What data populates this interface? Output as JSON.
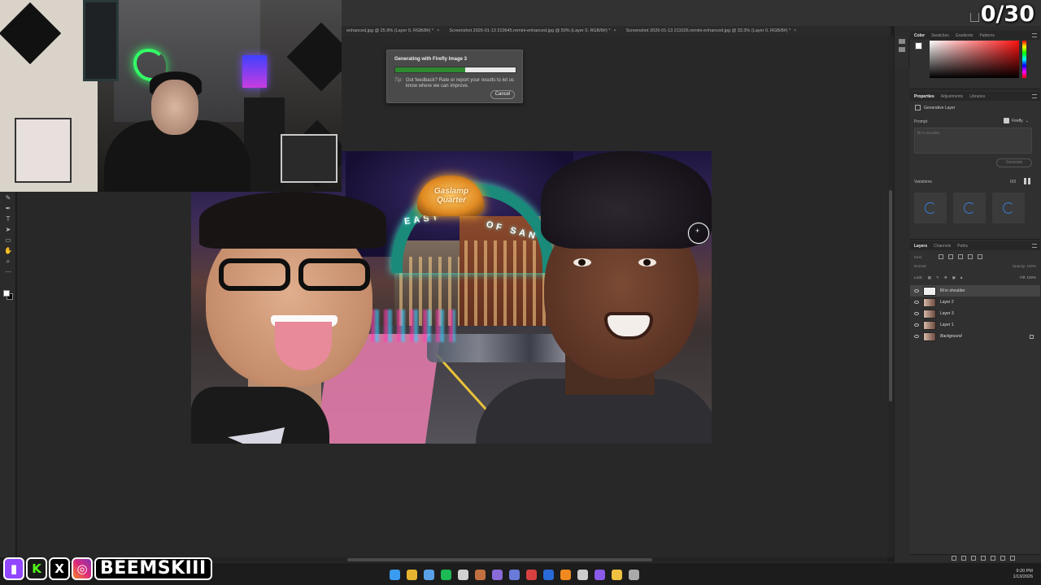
{
  "overlay": {
    "counter": "0/30",
    "handle": "BEEMSKIII",
    "social_icons": [
      "twitch-icon",
      "kick-icon",
      "x-icon",
      "instagram-icon"
    ]
  },
  "tabs": [
    {
      "label": "enhanced.jpg @ 25.9% (Layer 0, RGB/8#) *"
    },
    {
      "label": "Screenshot 2026-01-13 210645.remini-enhanced.jpg @ 50% (Layer 0, RGB/8#) *"
    },
    {
      "label": "Screenshot 2026-01-13 211026.remini-enhanced.jpg @ 33.3% (Layer 0, RGB/8#) *"
    }
  ],
  "dialog": {
    "title": "Generating with Firefly Image 3",
    "progress": 0.58,
    "tip_label": "Tip:",
    "tip_text": "Got feedback? Rate or report your results to let us know where we can improve.",
    "cancel_label": "Cancel"
  },
  "photo": {
    "sign_text": "Gaslamp Quarter",
    "arch_left": "EAST",
    "arch_right": "OF SAN"
  },
  "color_panel": {
    "tabs": [
      "Color",
      "Swatches",
      "Gradients",
      "Patterns"
    ],
    "active_tab": "Color"
  },
  "properties_panel": {
    "tabs": [
      "Properties",
      "Adjustments",
      "Libraries"
    ],
    "layer_type": "Generative Layer",
    "prompt_label": "Prompt",
    "model": "Firefly",
    "prompt_value": "fill in shoulder",
    "generate_label": "Generate",
    "variations_label": "Variations",
    "variations_count": "0/3"
  },
  "layers_panel": {
    "tabs": [
      "Layers",
      "Channels",
      "Paths"
    ],
    "filter_label": "Kind",
    "blend_mode": "Normal",
    "opacity_label": "Opacity:",
    "opacity_value": "100%",
    "lock_label": "Lock:",
    "fill_label": "Fill:",
    "fill_value": "100%",
    "layers": [
      {
        "name": "fill in shoulder",
        "active": true
      },
      {
        "name": "Layer 2",
        "active": false
      },
      {
        "name": "Layer 3",
        "active": false
      },
      {
        "name": "Layer 1",
        "active": false
      },
      {
        "name": "Background",
        "active": false
      }
    ]
  },
  "taskbar": {
    "apps": [
      {
        "name": "windows-start-icon",
        "color": "#3a9bf0"
      },
      {
        "name": "chrome-icon",
        "color": "#e8b530"
      },
      {
        "name": "capcut-icon",
        "color": "#5aa0e8"
      },
      {
        "name": "spotify-icon",
        "color": "#1db954"
      },
      {
        "name": "obs-icon",
        "color": "#d0d0d0"
      },
      {
        "name": "file-icon",
        "color": "#c07040"
      },
      {
        "name": "app-purple-icon",
        "color": "#8a6ad8"
      },
      {
        "name": "discord-icon",
        "color": "#6a7ad8"
      },
      {
        "name": "app-red-icon",
        "color": "#d84040"
      },
      {
        "name": "photoshop-icon",
        "color": "#2a6ad8"
      },
      {
        "name": "vlc-icon",
        "color": "#f08a20"
      },
      {
        "name": "app-dark-icon",
        "color": "#cccccc"
      },
      {
        "name": "premiere-icon",
        "color": "#8a5ae8"
      },
      {
        "name": "folder-icon",
        "color": "#f0c040"
      },
      {
        "name": "app-gray-icon",
        "color": "#aaaaaa"
      }
    ],
    "time": "9:20 PM",
    "date": "1/13/2026"
  }
}
